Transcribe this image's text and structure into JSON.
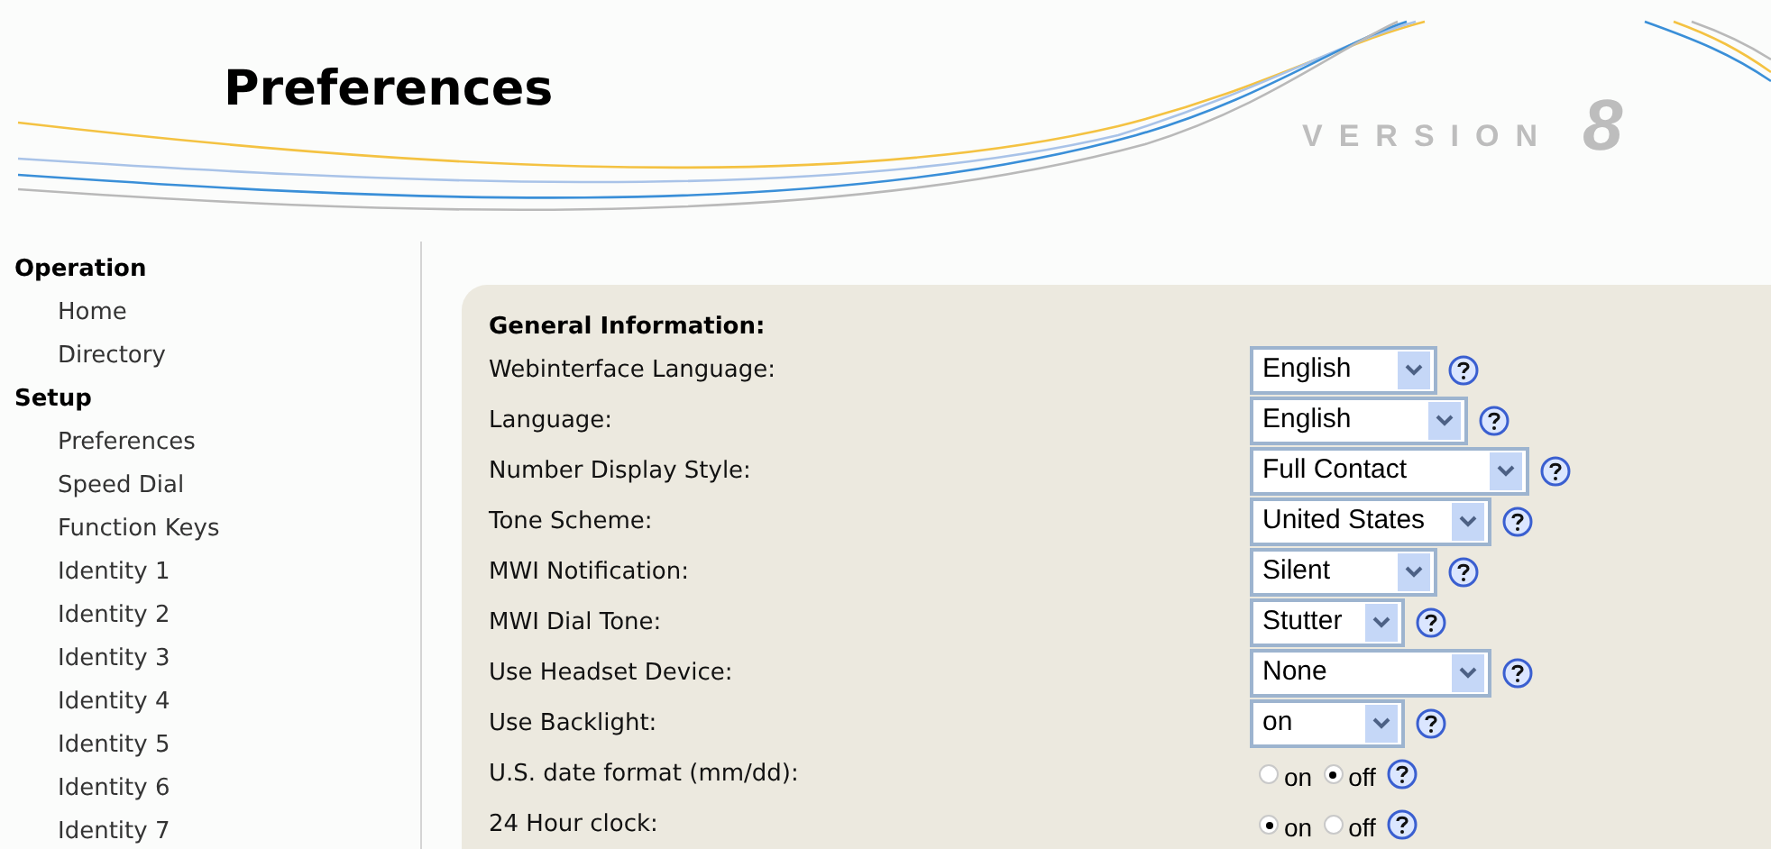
{
  "header": {
    "title": "Preferences",
    "version_label": "VERSION",
    "version_number": "8"
  },
  "sidebar": {
    "groups": [
      {
        "label": "Operation",
        "items": [
          {
            "label": "Home"
          },
          {
            "label": "Directory"
          }
        ]
      },
      {
        "label": "Setup",
        "items": [
          {
            "label": "Preferences"
          },
          {
            "label": "Speed Dial"
          },
          {
            "label": "Function Keys"
          },
          {
            "label": "Identity 1"
          },
          {
            "label": "Identity 2"
          },
          {
            "label": "Identity 3"
          },
          {
            "label": "Identity 4"
          },
          {
            "label": "Identity 5"
          },
          {
            "label": "Identity 6"
          },
          {
            "label": "Identity 7"
          }
        ]
      }
    ]
  },
  "section": {
    "title": "General Information:",
    "rows": [
      {
        "kind": "select",
        "label": "Webinterface Language:",
        "value": "English"
      },
      {
        "kind": "select",
        "label": "Language:",
        "value": "English"
      },
      {
        "kind": "select",
        "label": "Number Display Style:",
        "value": "Full Contact"
      },
      {
        "kind": "select",
        "label": "Tone Scheme:",
        "value": "United States"
      },
      {
        "kind": "select",
        "label": "MWI Notification:",
        "value": "Silent"
      },
      {
        "kind": "select",
        "label": "MWI Dial Tone:",
        "value": "Stutter"
      },
      {
        "kind": "select",
        "label": "Use Headset Device:",
        "value": "None"
      },
      {
        "kind": "select",
        "label": "Use Backlight:",
        "value": "on"
      },
      {
        "kind": "radio",
        "label": "U.S. date format (mm/dd):",
        "options": [
          {
            "label": "on",
            "selected": false
          },
          {
            "label": "off",
            "selected": true
          }
        ]
      },
      {
        "kind": "radio",
        "label": "24 Hour clock:",
        "options": [
          {
            "label": "on",
            "selected": true
          },
          {
            "label": "off",
            "selected": false
          }
        ]
      }
    ]
  }
}
